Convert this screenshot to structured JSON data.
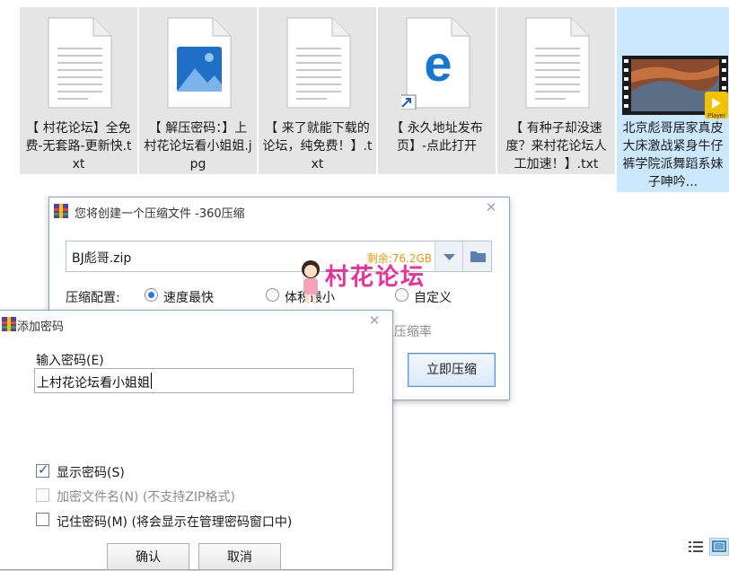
{
  "files": [
    {
      "name": "【 村花论坛】全免费-无套路-更新快.txt",
      "type": "txt",
      "icon": "text-file-icon"
    },
    {
      "name": "【 解压密码：】上村花论坛看小姐姐.jpg",
      "type": "jpg",
      "icon": "image-file-icon"
    },
    {
      "name": "【 来了就能下载的论坛，纯免费！】.txt",
      "type": "txt",
      "icon": "text-file-icon"
    },
    {
      "name": "【 永久地址发布页】-点此打开",
      "type": "url",
      "icon": "edge-shortcut-icon"
    },
    {
      "name": "【 有种子却没速度？来村花论坛人工加速！】.txt",
      "type": "txt",
      "icon": "text-file-icon"
    },
    {
      "name": "北京彪哥居家真皮大床激战紧身牛仔裤学院派舞蹈系妹子呻吟...",
      "type": "video",
      "icon": "video-file-icon",
      "badge": "Player"
    }
  ],
  "zip_dialog": {
    "title": "您将创建一个压缩文件 -360压缩",
    "filename": "BJ彪哥.zip",
    "free_space": "剩余:76.2GB",
    "config_label": "压缩配置:",
    "options": [
      "速度最快",
      "体积最小",
      "自定义"
    ],
    "selected_option": "速度最快",
    "ratio_label": "压缩率",
    "compress_button": "立即压缩"
  },
  "password_dialog": {
    "title": "添加密码",
    "input_label": "输入密码(E)",
    "password_value": "上村花论坛看小姐姐",
    "show_password": {
      "label": "显示密码(S)",
      "checked": true
    },
    "encrypt_names": {
      "label": "加密文件名(N) (不支持ZIP格式)",
      "checked": false,
      "disabled": true
    },
    "remember": {
      "label": "记住密码(M) (将会显示在管理密码窗口中)",
      "checked": false
    },
    "ok_button": "确认",
    "cancel_button": "取消"
  },
  "watermark": {
    "text": "村花论坛",
    "color": "#e8329a"
  },
  "colors": {
    "accent": "#2a78d8",
    "selection": "#cce8ff",
    "free_space": "#e39a11"
  }
}
